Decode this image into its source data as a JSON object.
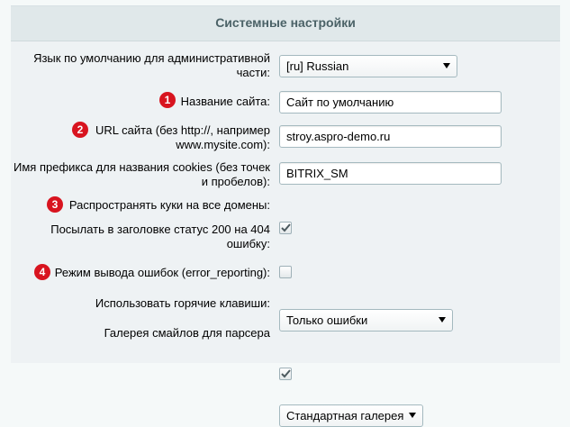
{
  "section": {
    "title": "Системные настройки"
  },
  "rows": [
    {
      "label_line1": "Язык по умолчанию для административной",
      "label_line2": "части:",
      "value": "[ru] Russian"
    },
    {
      "label": "Название сайта:",
      "value": "Сайт по умолчанию",
      "badge": "1"
    },
    {
      "label_line1": "URL сайта (без http://, например",
      "label_line2": "www.mysite.com):",
      "value": "stroy.aspro-demo.ru",
      "badge": "2"
    },
    {
      "label_line1": "Имя префикса для названия cookies (без точек",
      "label_line2": "и пробелов):",
      "value": "BITRIX_SM"
    },
    {
      "label": "Распространять куки на все домены:",
      "checked": true,
      "badge": "3"
    },
    {
      "label_line1": "Посылать в заголовке статус 200 на 404",
      "label_line2": "ошибку:",
      "checked": false
    },
    {
      "label": "Режим вывода ошибок (error_reporting):",
      "value": "Только ошибки",
      "badge": "4"
    },
    {
      "label": "Использовать горячие клавиши:",
      "checked": true
    },
    {
      "label": "Галерея смайлов для парсера",
      "value": "Стандартная галерея"
    }
  ],
  "colors": {
    "badge": "#d8141f",
    "header_bg": "#e0e8ea",
    "panel_bg": "#eef2f4"
  }
}
